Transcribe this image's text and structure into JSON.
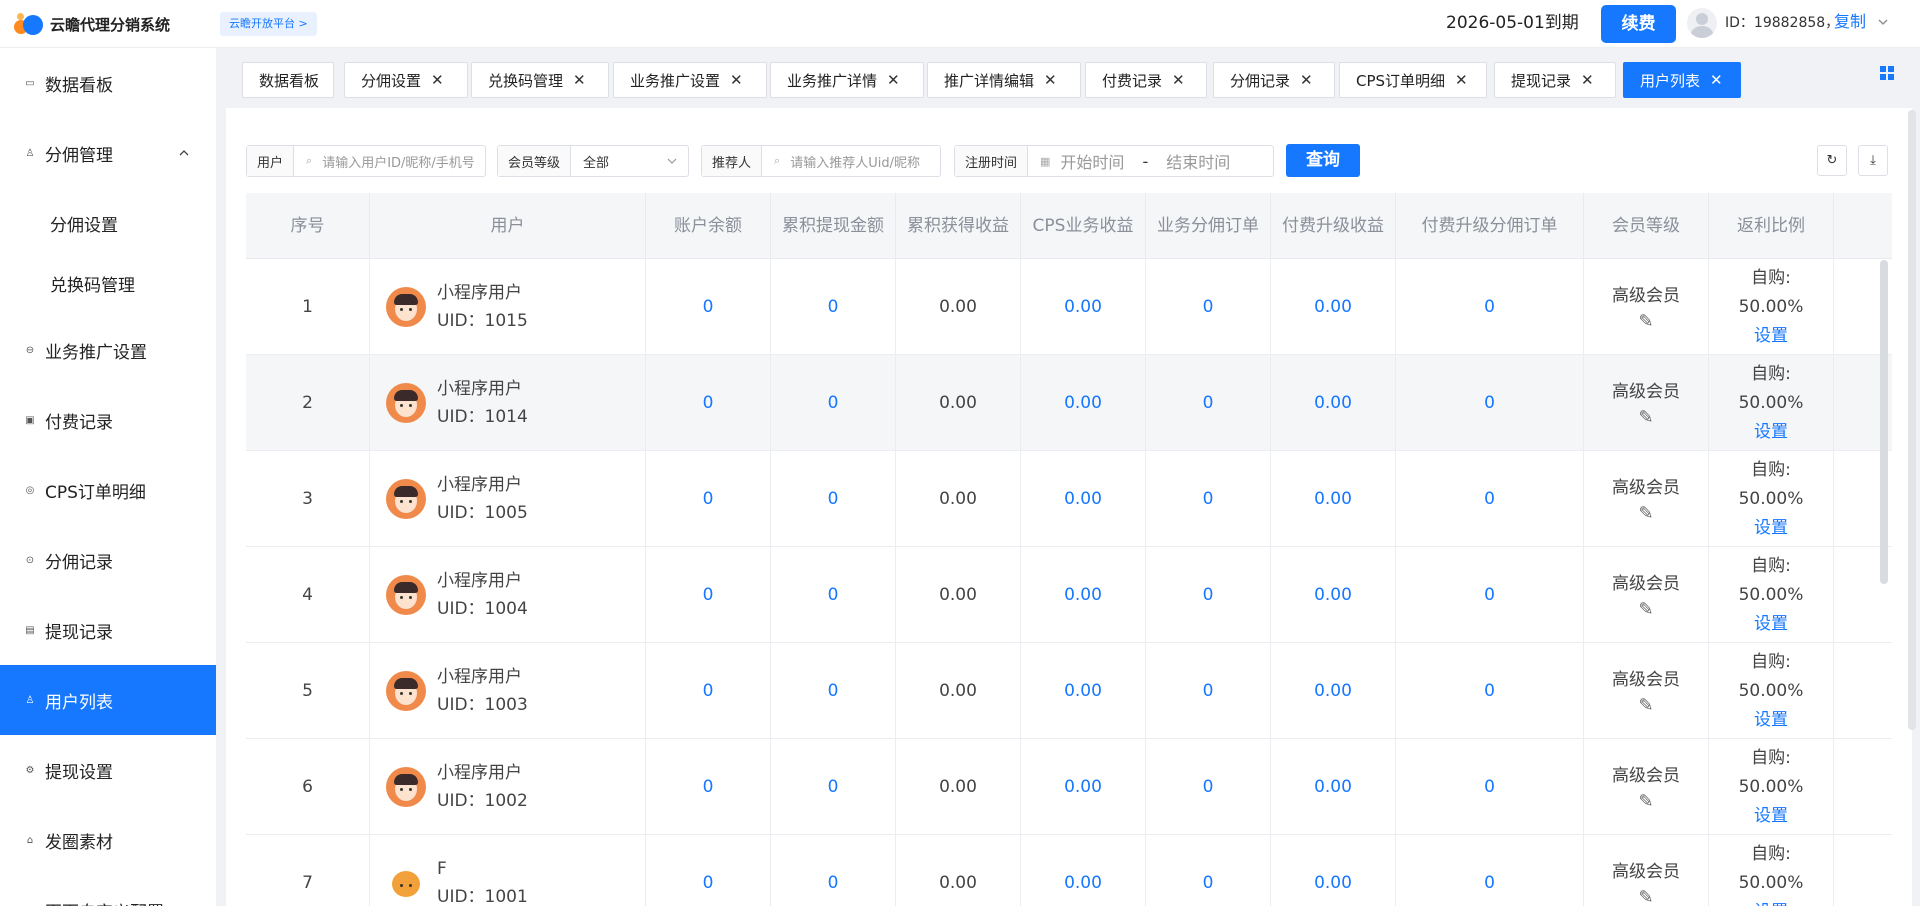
{
  "app": {
    "logo_text": "云瞻代理分销系统",
    "platform_badge": "云瞻开放平台 >",
    "expire_text": "2026-05-01到期",
    "renew_label": "续费",
    "uid_text": "ID：19882858，",
    "copy_label": "复制"
  },
  "sidebar": {
    "items": [
      {
        "label": "数据看板",
        "icon": "monitor-icon"
      },
      {
        "label": "分佣管理",
        "icon": "user-icon"
      },
      {
        "label": "分佣设置",
        "icon": ""
      },
      {
        "label": "兑换码管理",
        "icon": ""
      },
      {
        "label": "业务推广设置",
        "icon": "promo-icon"
      },
      {
        "label": "付费记录",
        "icon": "payment-icon"
      },
      {
        "label": "CPS订单明细",
        "icon": "order-icon"
      },
      {
        "label": "分佣记录",
        "icon": "record-icon"
      },
      {
        "label": "提现记录",
        "icon": "document-icon"
      },
      {
        "label": "用户列表",
        "icon": "user-icon"
      },
      {
        "label": "提现设置",
        "icon": "settings-icon"
      },
      {
        "label": "发圈素材",
        "icon": "material-icon"
      },
      {
        "label": "页面自定义配置",
        "icon": "page-icon"
      }
    ]
  },
  "tabs": [
    {
      "label": "数据看板"
    },
    {
      "label": "分佣设置"
    },
    {
      "label": "兑换码管理"
    },
    {
      "label": "业务推广设置"
    },
    {
      "label": "业务推广详情"
    },
    {
      "label": "推广详情编辑"
    },
    {
      "label": "付费记录"
    },
    {
      "label": "分佣记录"
    },
    {
      "label": "CPS订单明细"
    },
    {
      "label": "提现记录"
    },
    {
      "label": "用户列表"
    }
  ],
  "filters": {
    "user_label": "用户",
    "user_placeholder": "请输入用户ID/昵称/手机号",
    "level_label": "会员等级",
    "level_value": "全部",
    "referrer_label": "推荐人",
    "referrer_placeholder": "请输入推荐人Uid/昵称",
    "regtime_label": "注册时间",
    "start_placeholder": "开始时间",
    "range_sep": "-",
    "end_placeholder": "结束时间",
    "query_label": "查询"
  },
  "table": {
    "headers": [
      "序号",
      "用户",
      "账户余额",
      "累积提现金额",
      "累积获得收益",
      "CPS业务收益",
      "业务分佣订单",
      "付费升级收益",
      "付费升级分佣订单",
      "会员等级",
      "返利比例"
    ],
    "rows": [
      {
        "no": "1",
        "name": "小程序用户",
        "uid": "UID：1015",
        "balance": "0",
        "withdrawn": "0",
        "earned": "0.00",
        "cps": "0.00",
        "biz_orders": "0",
        "upgrade_income": "0.00",
        "upgrade_orders": "0",
        "level": "高级会员",
        "ratio_title": "自购:",
        "ratio_value": "50.00%",
        "set": "设置",
        "avatar": "boy"
      },
      {
        "no": "2",
        "name": "小程序用户",
        "uid": "UID：1014",
        "balance": "0",
        "withdrawn": "0",
        "earned": "0.00",
        "cps": "0.00",
        "biz_orders": "0",
        "upgrade_income": "0.00",
        "upgrade_orders": "0",
        "level": "高级会员",
        "ratio_title": "自购:",
        "ratio_value": "50.00%",
        "set": "设置",
        "avatar": "boy"
      },
      {
        "no": "3",
        "name": "小程序用户",
        "uid": "UID：1005",
        "balance": "0",
        "withdrawn": "0",
        "earned": "0.00",
        "cps": "0.00",
        "biz_orders": "0",
        "upgrade_income": "0.00",
        "upgrade_orders": "0",
        "level": "高级会员",
        "ratio_title": "自购:",
        "ratio_value": "50.00%",
        "set": "设置",
        "avatar": "boy"
      },
      {
        "no": "4",
        "name": "小程序用户",
        "uid": "UID：1004",
        "balance": "0",
        "withdrawn": "0",
        "earned": "0.00",
        "cps": "0.00",
        "biz_orders": "0",
        "upgrade_income": "0.00",
        "upgrade_orders": "0",
        "level": "高级会员",
        "ratio_title": "自购:",
        "ratio_value": "50.00%",
        "set": "设置",
        "avatar": "boy"
      },
      {
        "no": "5",
        "name": "小程序用户",
        "uid": "UID：1003",
        "balance": "0",
        "withdrawn": "0",
        "earned": "0.00",
        "cps": "0.00",
        "biz_orders": "0",
        "upgrade_income": "0.00",
        "upgrade_orders": "0",
        "level": "高级会员",
        "ratio_title": "自购:",
        "ratio_value": "50.00%",
        "set": "设置",
        "avatar": "boy"
      },
      {
        "no": "6",
        "name": "小程序用户",
        "uid": "UID：1002",
        "balance": "0",
        "withdrawn": "0",
        "earned": "0.00",
        "cps": "0.00",
        "biz_orders": "0",
        "upgrade_income": "0.00",
        "upgrade_orders": "0",
        "level": "高级会员",
        "ratio_title": "自购:",
        "ratio_value": "50.00%",
        "set": "设置",
        "avatar": "boy"
      },
      {
        "no": "7",
        "name": "F",
        "uid": "UID：1001",
        "balance": "0",
        "withdrawn": "0",
        "earned": "0.00",
        "cps": "0.00",
        "biz_orders": "0",
        "upgrade_income": "0.00",
        "upgrade_orders": "0",
        "level": "高级会员",
        "ratio_title": "自购:",
        "ratio_value": "50.00%",
        "set": "设置",
        "avatar": "cat"
      }
    ]
  },
  "colors": {
    "primary": "#1677ff",
    "brand_orange": "#ff8a1f"
  }
}
